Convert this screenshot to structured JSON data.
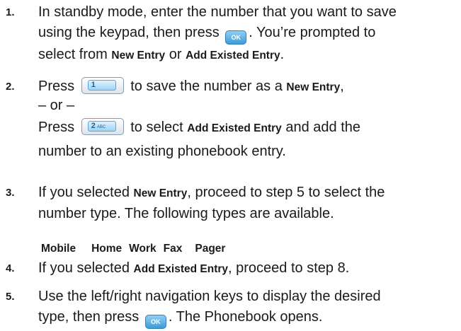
{
  "steps": [
    {
      "number": "1.",
      "text_1a": "In standby mode, enter the number that you want to save",
      "text_1b_pre": "using the keypad, then press",
      "text_1b_post": ". You’re prompted to",
      "text_1c_pre": "select from",
      "text_1c_bold1": "New Entry",
      "text_1c_mid": "or",
      "text_1c_bold2": "Add Existed Entry",
      "text_1c_post": "."
    },
    {
      "number": "2.",
      "text_2a_pre": "Press",
      "text_2a_post": "to save the number as a",
      "text_2a_bold": "New Entry",
      "text_2a_end": ",",
      "text_2b": "– or –",
      "text_2c_pre": "Press",
      "text_2c_post": "to select",
      "text_2c_bold": "Add Existed Entry",
      "text_2c_end": "and add the",
      "text_2d": "number to an existing phonebook entry."
    },
    {
      "number": "3.",
      "text_3a_pre": "If you selected",
      "text_3a_bold": "New Entry",
      "text_3a_post": ", proceed to step 5 to select the",
      "text_3b": "number type. The following types are available."
    },
    {
      "number": "4.",
      "text_4_pre": "If you selected",
      "text_4_bold": "Add Existed Entry",
      "text_4_post": ", proceed to step 8."
    },
    {
      "number": "5.",
      "text_5a": "Use the left/right navigation keys to display the desired",
      "text_5b_pre": "type, then press",
      "text_5b_post": ". The Phonebook opens."
    }
  ],
  "number_types": [
    "Mobile",
    "Home",
    "Work",
    "Fax",
    "Pager"
  ],
  "keys": {
    "ok_label": "OK",
    "key1_label": "1",
    "key2_label": "2",
    "key2_sub": "ABC"
  },
  "colors": {
    "ok_key": "#3f9ad8",
    "num_key_face": "#9fd3f5",
    "text": "#1a1a1a"
  },
  "icons": {
    "ok_key": "ok-key-icon",
    "key1": "key-1-icon",
    "key2": "key-2-icon"
  }
}
